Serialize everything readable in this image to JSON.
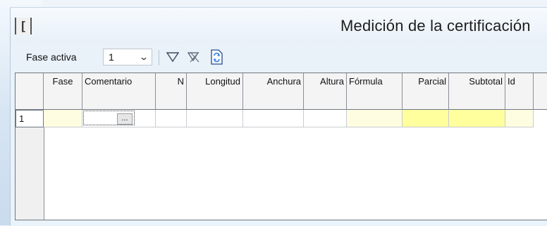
{
  "window": {
    "title": "Medición de la certificación",
    "app_icon_glyph": "["
  },
  "toolbar": {
    "fase_label": "Fase activa",
    "fase_value": "1",
    "icons": [
      "filter-icon",
      "clear-filter-icon",
      "refresh-icon"
    ]
  },
  "grid": {
    "columns": [
      "Fase",
      "Comentario",
      "N",
      "Longitud",
      "Anchura",
      "Altura",
      "Fórmula",
      "Parcial",
      "Subtotal",
      "Id"
    ],
    "rows": [
      {
        "row_number": "1",
        "cells": [
          "",
          "",
          "",
          "",
          "",
          "",
          "",
          "",
          "",
          ""
        ]
      }
    ],
    "edit_button_label": "..."
  },
  "colors": {
    "yellow_cell": "#ffff9e",
    "pale_yellow_cell": "#fffde1",
    "grid_border": "#6f7780"
  }
}
